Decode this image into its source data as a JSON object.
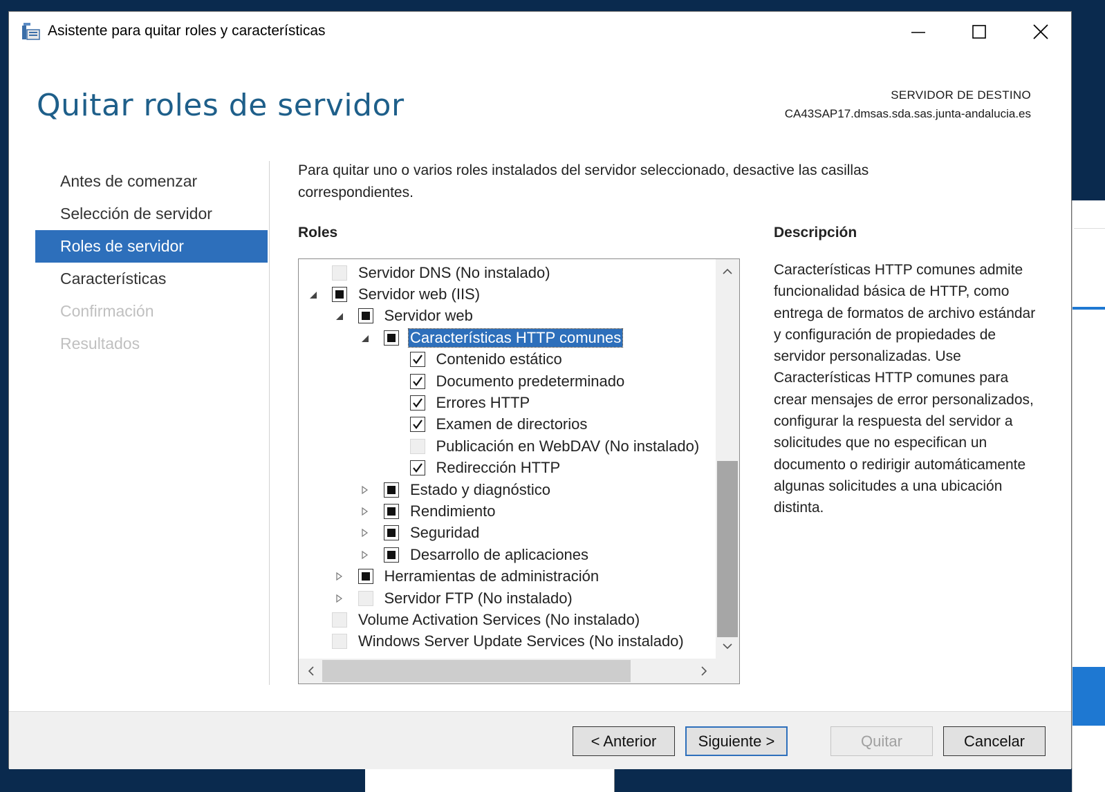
{
  "window": {
    "title": "Asistente para quitar roles y características"
  },
  "header": {
    "page_title": "Quitar roles de servidor",
    "destination_label": "SERVIDOR DE DESTINO",
    "destination_server": "CA43SAP17.dmsas.sda.sas.junta-andalucia.es"
  },
  "nav": {
    "items": [
      {
        "label": "Antes de comenzar",
        "state": "normal"
      },
      {
        "label": "Selección de servidor",
        "state": "normal"
      },
      {
        "label": "Roles de servidor",
        "state": "active"
      },
      {
        "label": "Características",
        "state": "normal"
      },
      {
        "label": "Confirmación",
        "state": "disabled"
      },
      {
        "label": "Resultados",
        "state": "disabled"
      }
    ]
  },
  "main": {
    "instructions": "Para quitar uno o varios roles instalados del servidor seleccionado, desactive las casillas correspondientes.",
    "roles_heading": "Roles",
    "tree": [
      {
        "label": "Servidor DNS (No instalado)",
        "level": 0,
        "expander": "none",
        "check": "disabled"
      },
      {
        "label": "Servidor web (IIS)",
        "level": 0,
        "expander": "expanded",
        "check": "partial"
      },
      {
        "label": "Servidor web",
        "level": 1,
        "expander": "expanded",
        "check": "partial"
      },
      {
        "label": "Características HTTP comunes",
        "level": 2,
        "expander": "expanded",
        "check": "partial",
        "selected": true
      },
      {
        "label": "Contenido estático",
        "level": 3,
        "expander": "none",
        "check": "checked"
      },
      {
        "label": "Documento predeterminado",
        "level": 3,
        "expander": "none",
        "check": "checked"
      },
      {
        "label": "Errores HTTP",
        "level": 3,
        "expander": "none",
        "check": "checked"
      },
      {
        "label": "Examen de directorios",
        "level": 3,
        "expander": "none",
        "check": "checked"
      },
      {
        "label": "Publicación en WebDAV (No instalado)",
        "level": 3,
        "expander": "none",
        "check": "disabled"
      },
      {
        "label": "Redirección HTTP",
        "level": 3,
        "expander": "none",
        "check": "checked"
      },
      {
        "label": "Estado y diagnóstico",
        "level": 2,
        "expander": "collapsed",
        "check": "partial"
      },
      {
        "label": "Rendimiento",
        "level": 2,
        "expander": "collapsed",
        "check": "partial"
      },
      {
        "label": "Seguridad",
        "level": 2,
        "expander": "collapsed",
        "check": "partial"
      },
      {
        "label": "Desarrollo de aplicaciones",
        "level": 2,
        "expander": "collapsed",
        "check": "partial"
      },
      {
        "label": "Herramientas de administración",
        "level": 1,
        "expander": "collapsed",
        "check": "partial"
      },
      {
        "label": "Servidor FTP (No instalado)",
        "level": 1,
        "expander": "collapsed",
        "check": "disabled"
      },
      {
        "label": "Volume Activation Services (No instalado)",
        "level": 0,
        "expander": "none",
        "check": "disabled"
      },
      {
        "label": "Windows Server Update Services (No instalado)",
        "level": 0,
        "expander": "none",
        "check": "disabled"
      }
    ],
    "description_heading": "Descripción",
    "description_text": "Características HTTP comunes admite funcionalidad básica de HTTP, como entrega de formatos de archivo estándar y configuración de propiedades de servidor personalizadas. Use Características HTTP comunes para crear mensajes de error personalizados, configurar la respuesta del servidor a solicitudes que no especifican un documento o redirigir automáticamente algunas solicitudes a una ubicación distinta."
  },
  "footer": {
    "prev_label": "< Anterior",
    "next_label": "Siguiente >",
    "remove_label": "Quitar",
    "cancel_label": "Cancelar"
  },
  "colors": {
    "accent": "#2d6fbb",
    "title_blue": "#1e5f8a",
    "desktop": "#0a2a4e"
  }
}
